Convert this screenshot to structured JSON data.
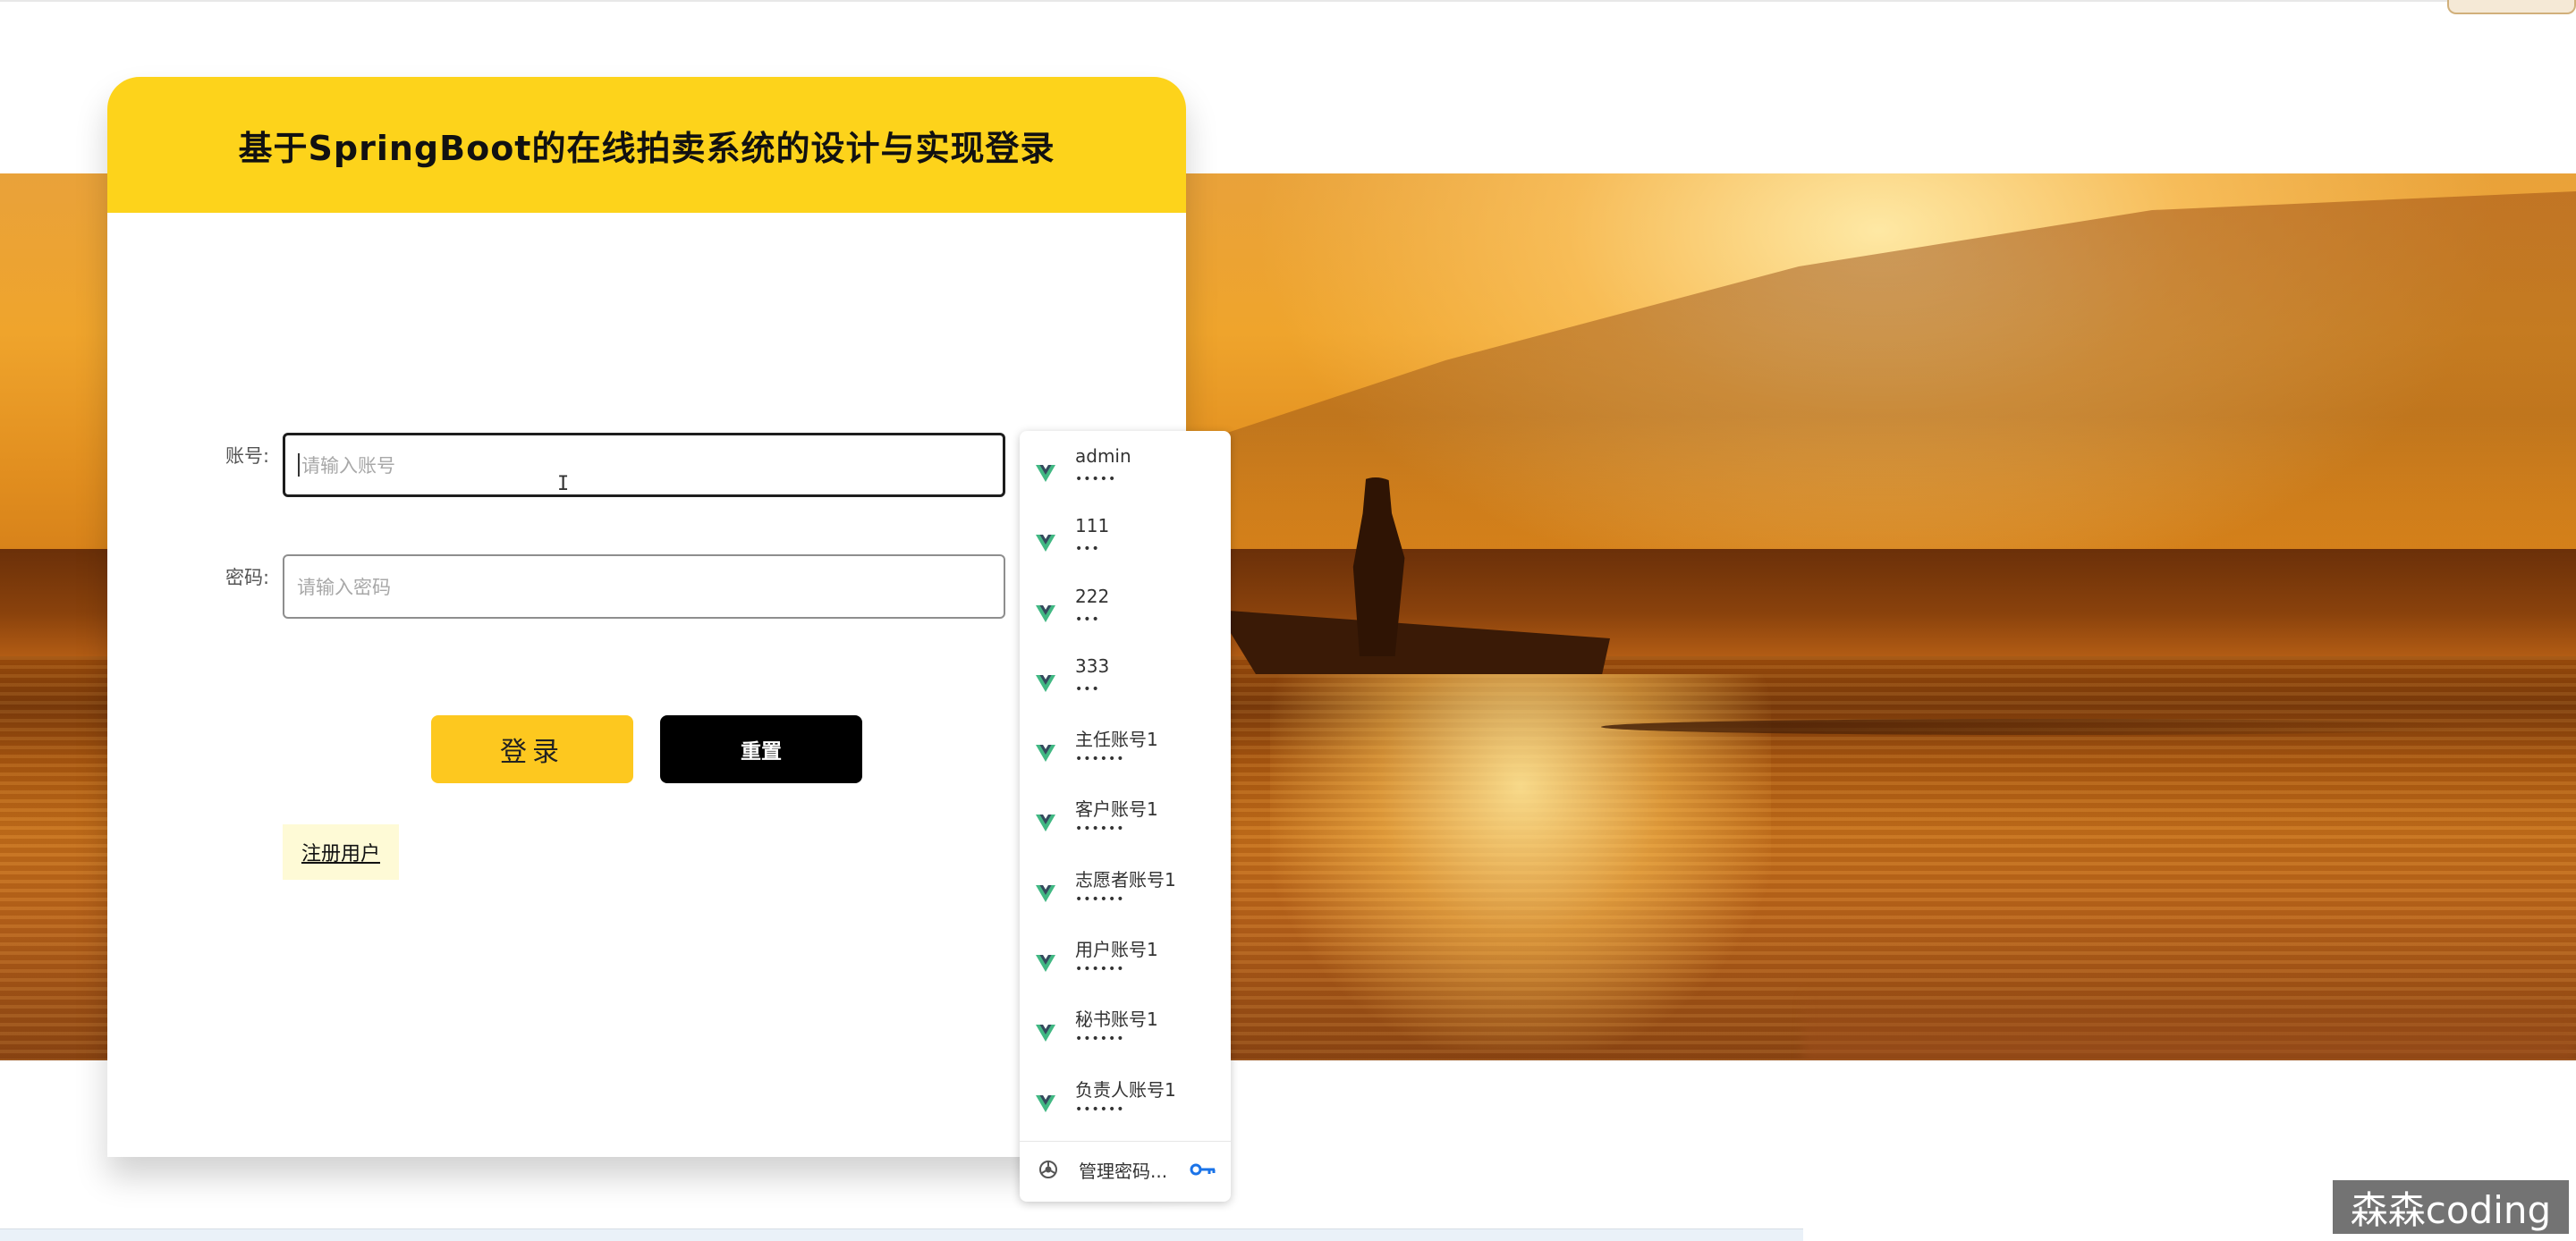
{
  "card": {
    "title": "基于SpringBoot的在线拍卖系统的设计与实现登录",
    "header_color": "#fdd31b"
  },
  "form": {
    "account_label": "账号:",
    "account_placeholder": "请输入账号",
    "password_label": "密码:",
    "password_placeholder": "请输入密码",
    "login_button": "登录",
    "reset_button": "重置",
    "register_link": "注册用户"
  },
  "autofill": {
    "items": [
      {
        "username": "admin",
        "mask": "•••••"
      },
      {
        "username": "111",
        "mask": "•••"
      },
      {
        "username": "222",
        "mask": "•••"
      },
      {
        "username": "333",
        "mask": "•••"
      },
      {
        "username": "主任账号1",
        "mask": "••••••"
      },
      {
        "username": "客户账号1",
        "mask": "••••••"
      },
      {
        "username": "志愿者账号1",
        "mask": "••••••"
      },
      {
        "username": "用户账号1",
        "mask": "••••••"
      },
      {
        "username": "秘书账号1",
        "mask": "••••••"
      },
      {
        "username": "负责人账号1",
        "mask": "••••••"
      }
    ],
    "manage_label": "管理密码...",
    "item_icon": "vue-logo-icon",
    "item_icon_colors": [
      "#41b883",
      "#35495e"
    ]
  },
  "watermark": {
    "text": "森森coding"
  },
  "colors": {
    "login_button": "#fdc81f",
    "reset_button": "#000000",
    "register_bg": "#fefad6"
  }
}
